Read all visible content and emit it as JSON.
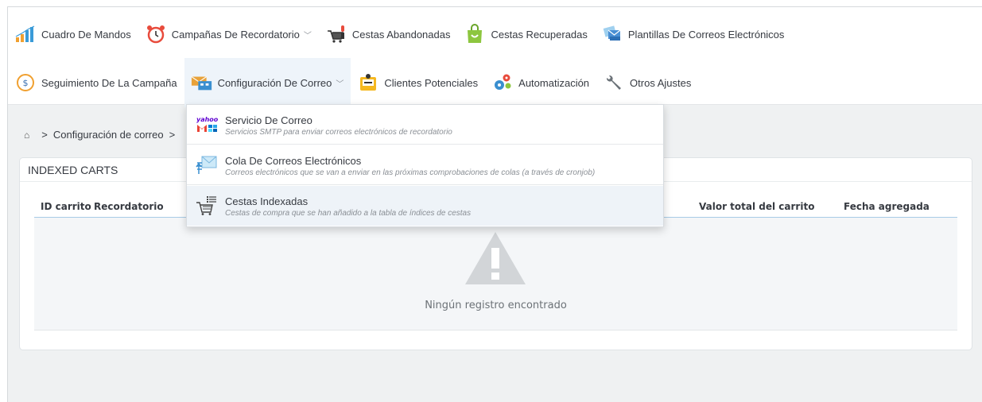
{
  "nav": {
    "row1": [
      {
        "label": "Cuadro De Mandos",
        "icon": "bar-chart-icon"
      },
      {
        "label": "Campañas De Recordatorio",
        "icon": "alarm-clock-icon",
        "dropdown": true
      },
      {
        "label": "Cestas Abandonadas",
        "icon": "abandoned-cart-icon"
      },
      {
        "label": "Cestas Recuperadas",
        "icon": "recovered-bag-icon"
      },
      {
        "label": "Plantillas De Correos Electrónicos",
        "icon": "email-templates-icon"
      }
    ],
    "row2": [
      {
        "label": "Seguimiento De La Campaña",
        "icon": "campaign-tracking-icon"
      },
      {
        "label": "Configuración De Correo",
        "icon": "mail-config-icon",
        "dropdown": true,
        "active": true
      },
      {
        "label": "Clientes Potenciales",
        "icon": "leads-icon"
      },
      {
        "label": "Automatización",
        "icon": "gears-icon"
      },
      {
        "label": "Otros Ajustes",
        "icon": "wrench-icon"
      }
    ]
  },
  "dropdown": {
    "items": [
      {
        "title": "Servicio De Correo",
        "subtitle": "Servicios SMTP para enviar correos electrónicos de recordatorio",
        "icon": "mail-service-logos-icon"
      },
      {
        "title": "Cola De Correos Electrónicos",
        "subtitle": "Correos electrónicos que se van a enviar en las próximas comprobaciones de colas (a través de cronjob)",
        "icon": "mail-queue-icon"
      },
      {
        "title": "Cestas Indexadas",
        "subtitle": "Cestas de compra que se han añadido a la tabla de índices de cestas",
        "icon": "indexed-carts-icon"
      }
    ]
  },
  "breadcrumb": {
    "home_icon": "home-icon",
    "separator": ">",
    "current": "Configuración de correo",
    "trailing": ">"
  },
  "panel": {
    "title": "INDEXED CARTS",
    "columns": [
      "ID carrito",
      "Recordatorio",
      "Valor total del carrito",
      "Fecha agregada"
    ],
    "empty_message": "Ningún registro encontrado"
  },
  "colors": {
    "active_nav_bg": "#eef4fa",
    "header_underline": "#a8cbe6",
    "text": "#363a41"
  }
}
